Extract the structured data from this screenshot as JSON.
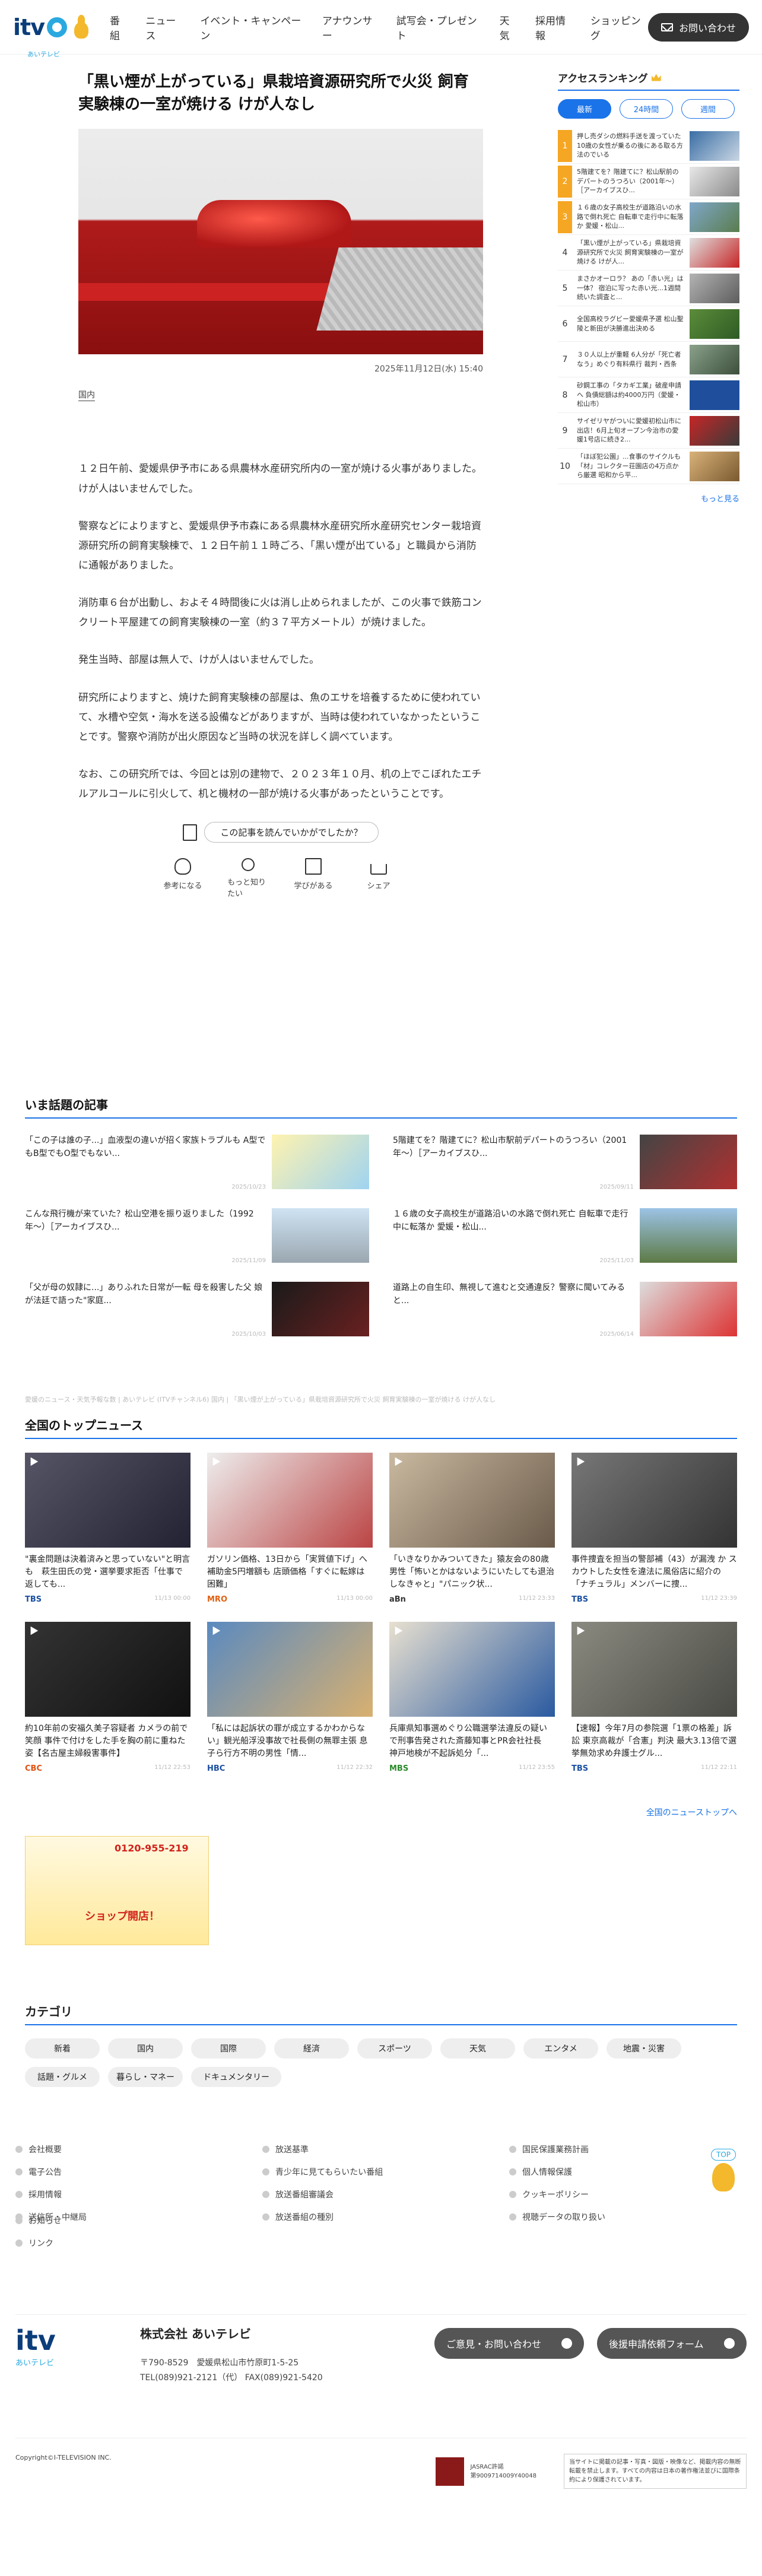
{
  "header": {
    "logo_text": "itv",
    "logo_sub": "あいテレビ",
    "nav": [
      "番組",
      "ニュース",
      "イベント・キャンペーン",
      "アナウンサー",
      "試写会・プレゼント",
      "天気",
      "採用情報",
      "ショッピング"
    ],
    "contact_label": "お問い合わせ"
  },
  "article": {
    "title": "「黒い煙が上がっている」県栽培資源研究所で火災 飼育実験棟の一室が焼ける けが人なし",
    "date": "2025年11月12日(水) 15:40",
    "category": "国内",
    "paragraphs": [
      "１２日午前、愛媛県伊予市にある県農林水産研究所内の一室が焼ける火事がありました。けが人はいませんでした。",
      "警察などによりますと、愛媛県伊予市森にある県農林水産研究所水産研究センター栽培資源研究所の飼育実験棟で、１２日午前１１時ごろ、「黒い煙が出ている」と職員から消防に通報がありました。",
      "消防車６台が出動し、およそ４時間後に火は消し止められましたが、この火事で鉄筋コンクリート平屋建ての飼育実験棟の一室（約３７平方メートル）が焼けました。",
      "発生当時、部屋は無人で、けが人はいませんでした。",
      "研究所によりますと、焼けた飼育実験棟の部屋は、魚のエサを培養するために使われていて、水槽や空気・海水を送る設備などがありますが、当時は使われていなかったということです。警察や消防が出火原因など当時の状況を詳しく調べています。",
      "なお、この研究所では、今回とは別の建物で、２０２３年１０月、机の上でこぼれたエチルアルコールに引火して、机と機材の一部が焼ける火事があったということです。"
    ],
    "read_question": "この記事を読んでいかがでしたか？",
    "reactions": [
      "参考になる",
      "もっと知りたい",
      "学びがある",
      "シェア"
    ]
  },
  "ranking": {
    "title": "アクセスランキング",
    "tabs": [
      "最新",
      "24時間",
      "週間"
    ],
    "items": [
      {
        "num": "1",
        "text": "押し売ダシの燃料手送を渡っていた10歳の女性が乗るの後にある取る方法のでいる"
      },
      {
        "num": "2",
        "text": "5階建てを？階建てに？松山駅前のデパートのうつろい（2001年〜）［アーカイブスひ..."
      },
      {
        "num": "3",
        "text": "１６歳の女子高校生が道路沿いの水路で倒れ死亡 自転車で走行中に転落か 愛媛・松山..."
      },
      {
        "num": "4",
        "text": "「黒い煙が上がっている」県栽培資源研究所で火災 飼育実験棟の一室が焼ける けが人..."
      },
      {
        "num": "5",
        "text": "まさかオーロラ？ あの「赤い光」は一体？ 宿泊に写った赤い光...1週間続いた調査と..."
      },
      {
        "num": "6",
        "text": "全国高校ラグビー愛媛県予選 松山聖陵と新田が決勝進出決める"
      },
      {
        "num": "7",
        "text": "３０人以上が重軽 6人分が「死亡者なう」めぐり有料県行 裁判・西条"
      },
      {
        "num": "8",
        "text": "砂鋼工事の「タカギ工業」破産申請へ 負債総額は約4000万円（愛媛・松山市）"
      },
      {
        "num": "9",
        "text": "サイゼリヤがついに愛媛初松山市に出店！6月上旬オープン今治市の愛媛1号店に続き2..."
      },
      {
        "num": "10",
        "text": "「ほぼ犯公園」...食事のサイクルも「材」コレクター荘園店の4万点から厳選 昭和から平..."
      }
    ],
    "more": "もっと見る"
  },
  "hot": {
    "title": "いま話題の記事",
    "items": [
      {
        "text": "「この子は誰の子...」血液型の違いが招く家族トラブルも A型でもB型でもO型でもない...",
        "date": "2025/10/23"
      },
      {
        "text": "5階建てを？階建てに？松山市駅前デパートのうつろい（2001年〜）［アーカイブスひ...",
        "date": "2025/09/11"
      },
      {
        "text": "こんな飛行機が来ていた？松山空港を振り返りました（1992年〜）［アーカイブスひ...",
        "date": "2025/11/09"
      },
      {
        "text": "１６歳の女子高校生が道路沿いの水路で倒れ死亡 自転車で走行中に転落か 愛媛・松山...",
        "date": "2025/11/03"
      },
      {
        "text": "「父が母の奴隷に...」ありふれた日常が一転 母を殺害した父 娘が法廷で語った\"家庭...",
        "date": "2025/10/03"
      },
      {
        "text": "道路上の自生印、無視して進むと交通違反？警察に聞いてみると...",
        "date": "2025/06/14"
      }
    ]
  },
  "breadcrumb": "愛媛のニュース・天気予報な数 | あいテレビ (ITVチャンネル6) 国内 | 「黒い煙が上がっている」県栽培資源研究所で火災 飼育実験棟の一室が焼ける けが人なし",
  "top_news": {
    "title": "全国のトップニュース",
    "items": [
      {
        "text": "\"裏金問題は決着済みと思っていない\"と明言も　萩生田氏の党・選挙要求拒否「仕事で返しても...",
        "src": "TBS",
        "date": "11/13 00:00"
      },
      {
        "text": "ガソリン価格、13日から「実質値下げ」へ 補助金5円増額も 店頭価格「すぐに転嫁は困難」",
        "src": "MRO",
        "date": "11/13 00:00"
      },
      {
        "text": "「いきなりかみついてきた」猿友会の80歳男性「怖いとかはないようにいたしても退治しなきゃと」\"パニック状...",
        "src": "aBn",
        "date": "11/12 23:33"
      },
      {
        "text": "事件捜査を担当の警部補（43）が漏洩 か スカウトした女性を違法に風俗店に紹介の「ナチュラル」メンバーに捜...",
        "src": "TBS",
        "date": "11/12 23:39"
      },
      {
        "text": "約10年前の安福久美子容疑者 カメラの前で笑顔 事件で付けをした手を胸の前に重ねた姿【名古屋主婦殺害事件】",
        "src": "CBC",
        "date": "11/12 22:53"
      },
      {
        "text": "「私には起訴状の罪が成立するかわからない」観光船浮没事故で社長側の無罪主張 息子ら行方不明の男性「情...",
        "src": "HBC",
        "date": "11/12 22:32"
      },
      {
        "text": "兵庫県知事選めぐり公職選挙法違反の疑いで刑事告発された斎藤知事とPR会社社長　神戸地検が不起訴処分「...",
        "src": "MBS",
        "date": "11/12 23:55"
      },
      {
        "text": "【速報】今年7月の参院選「1票の格差」訴訟 東京高裁が「合憲」判決 最大3.13倍で選挙無効求め弁護士グル...",
        "src": "TBS",
        "date": "11/12 22:11"
      }
    ],
    "more": "全国のニューストップへ"
  },
  "banner": {
    "phone": "0120-955-219",
    "text": "ショップ開店！"
  },
  "categories": {
    "title": "カテゴリ",
    "items": [
      "新着",
      "国内",
      "国際",
      "経済",
      "スポーツ",
      "天気",
      "エンタメ",
      "地震・災害",
      "話題・グルメ",
      "暮らし・マネー",
      "ドキュメンタリー"
    ]
  },
  "footer": {
    "links": [
      "会社概要",
      "放送基準",
      "国民保護業務計画",
      "電子公告",
      "青少年に見てもらいたい番組",
      "個人情報保護",
      "採用情報",
      "放送番組審議会",
      "クッキーポリシー",
      "送信所・中継局",
      "放送番組の種別",
      "視聴データの取り扱い"
    ],
    "links2": [
      "お知らせ",
      "リンク"
    ],
    "to_top": "TOP"
  },
  "company": {
    "logo_text": "itv",
    "logo_sub": "あいテレビ",
    "name": "株式会社 あいテレビ",
    "address": "〒790-8529　愛媛県松山市竹原町1-5-25",
    "tel": "TEL(089)921-2121（代）  FAX(089)921-5420",
    "btn1": "ご意見・お問い合わせ",
    "btn2": "後援申請依頼フォーム"
  },
  "bottom": {
    "copyright": "Copyright©I-TELEVISION INC.",
    "jasrac": "JASRAC許諾\n第9009714009Y40048",
    "notice": "当サイトに掲載の記事・写真・図版・映像など、掲載内容の無断転載を禁止します。すべての内容は日本の著作権法並びに国際条約により保護されています。"
  },
  "colors": {
    "accent": "#1a73e8",
    "brand_navy": "#0b3d7a",
    "brand_sky": "#2aa9e0",
    "rank_gold": "#f5a623"
  }
}
